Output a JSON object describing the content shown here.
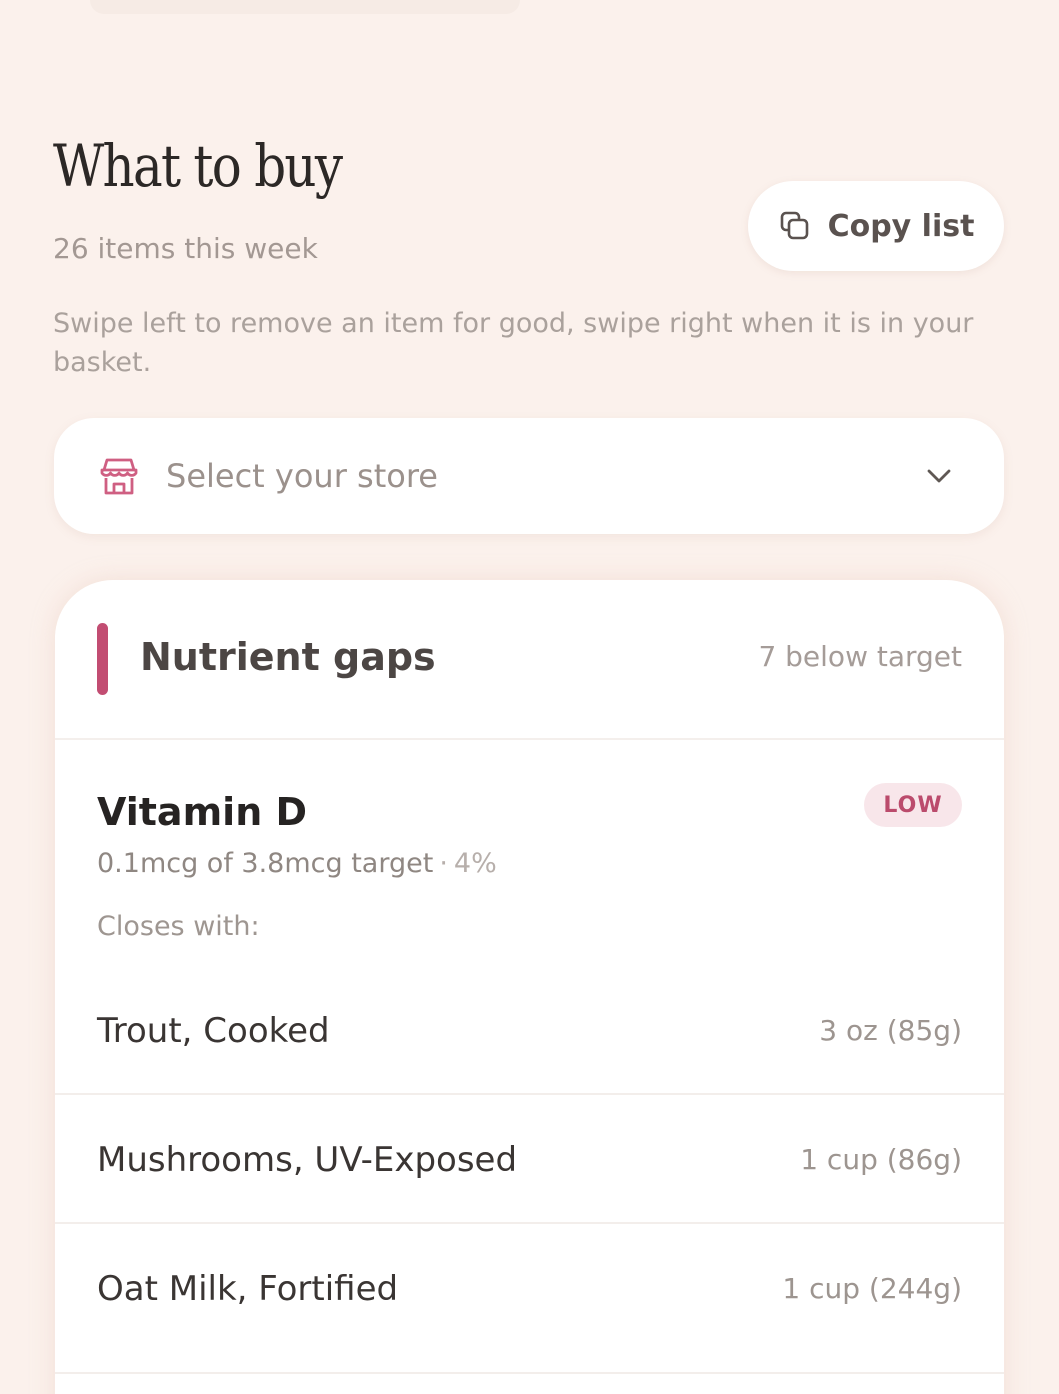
{
  "header": {
    "title": "What to buy",
    "subtitle": "26 items this week",
    "copy_button_label": "Copy list",
    "helper_text": "Swipe left to remove an item for good, swipe right when it is in your basket."
  },
  "store_select": {
    "placeholder": "Select your store",
    "icon": "store-icon"
  },
  "nutrient_gaps": {
    "title": "Nutrient gaps",
    "count_label": "7 below target",
    "accent_color": "#c24d72",
    "nutrients": [
      {
        "name": "Vitamin D",
        "badge": "LOW",
        "detail": "0.1mcg of 3.8mcg target",
        "separator": "·",
        "percent": "4%",
        "closes_label": "Closes with:",
        "foods": [
          {
            "name": "Trout, Cooked",
            "amount": "3 oz (85g)"
          },
          {
            "name": "Mushrooms, UV-Exposed",
            "amount": "1 cup (86g)"
          },
          {
            "name": "Oat Milk, Fortified",
            "amount": "1 cup (244g)"
          }
        ]
      }
    ]
  },
  "colors": {
    "background": "#fbf1ec",
    "card": "#ffffff",
    "accent": "#c24d72",
    "badge_bg": "#f8e6ea"
  }
}
